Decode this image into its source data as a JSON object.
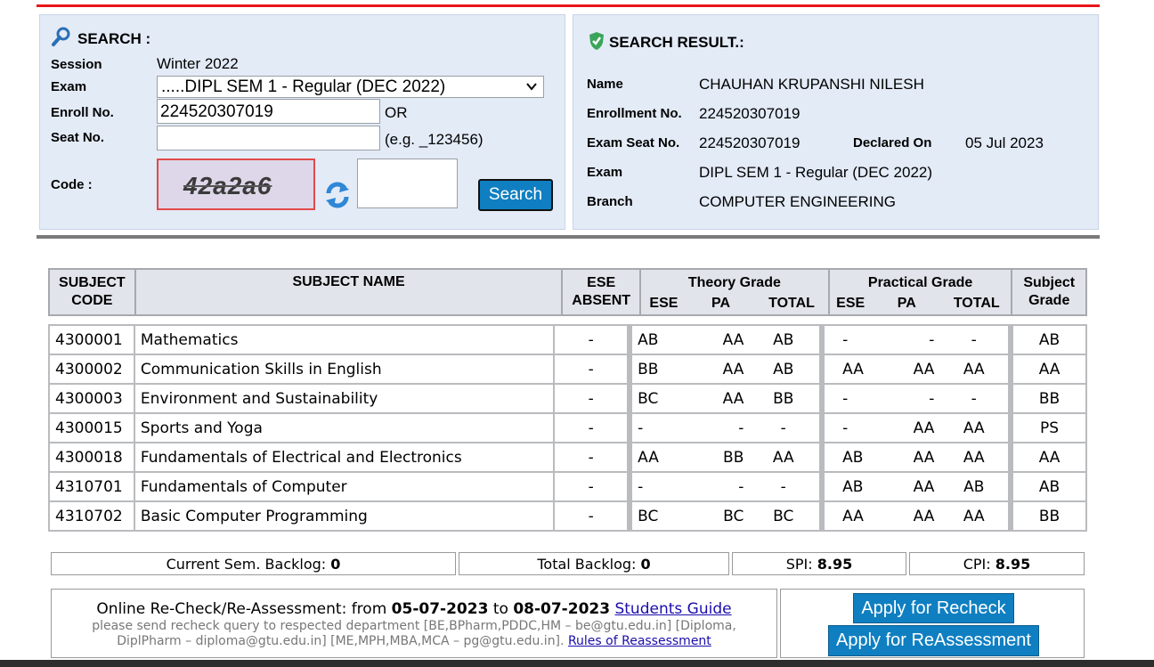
{
  "search_panel": {
    "title": "SEARCH :",
    "session_label": "Session",
    "session_value": "Winter 2022",
    "exam_label": "Exam",
    "exam_selected": ".....DIPL SEM 1 - Regular (DEC 2022)",
    "enroll_label": "Enroll No.",
    "enroll_value": "224520307019",
    "or_text": "OR",
    "seat_label": "Seat No.",
    "seat_value": "",
    "seat_hint": "(e.g. _123456)",
    "code_label": "Code :",
    "captcha_text": "42a2a6",
    "code_value": "",
    "search_button": "Search"
  },
  "result_panel": {
    "title": "SEARCH RESULT.:",
    "name_label": "Name",
    "name_value": "CHAUHAN KRUPANSHI NILESH",
    "enrollment_label": "Enrollment No.",
    "enrollment_value": "224520307019",
    "seat_label": "Exam Seat No.",
    "seat_value": "224520307019",
    "declared_label": "Declared On",
    "declared_value": "05 Jul 2023",
    "exam_label": "Exam",
    "exam_value": "DIPL SEM 1 - Regular (DEC 2022)",
    "branch_label": "Branch",
    "branch_value": "COMPUTER ENGINEERING"
  },
  "table_header": {
    "subject_code_1": "SUBJECT",
    "subject_code_2": "CODE",
    "subject_name": "SUBJECT NAME",
    "ese_absent_1": "ESE",
    "ese_absent_2": "ABSENT",
    "theory_grade": "Theory Grade",
    "practical_grade": "Practical Grade",
    "subject_grade_1": "Subject",
    "subject_grade_2": "Grade",
    "sub_ese": "ESE",
    "sub_pa": "PA",
    "sub_total": "TOTAL"
  },
  "rows": [
    {
      "code": "4300001",
      "name": "Mathematics",
      "absent": "-",
      "t_ese": "AB",
      "t_pa": "AA",
      "t_total": "AB",
      "p_ese": "-",
      "p_pa": "-",
      "p_total": "-",
      "grade": "AB"
    },
    {
      "code": "4300002",
      "name": "Communication Skills in English",
      "absent": "-",
      "t_ese": "BB",
      "t_pa": "AA",
      "t_total": "AB",
      "p_ese": "AA",
      "p_pa": "AA",
      "p_total": "AA",
      "grade": "AA"
    },
    {
      "code": "4300003",
      "name": "Environment and Sustainability",
      "absent": "-",
      "t_ese": "BC",
      "t_pa": "AA",
      "t_total": "BB",
      "p_ese": "-",
      "p_pa": "-",
      "p_total": "-",
      "grade": "BB"
    },
    {
      "code": "4300015",
      "name": "Sports and Yoga",
      "absent": "-",
      "t_ese": "-",
      "t_pa": "-",
      "t_total": "-",
      "p_ese": "-",
      "p_pa": "AA",
      "p_total": "AA",
      "grade": "PS"
    },
    {
      "code": "4300018",
      "name": "Fundamentals of Electrical and Electronics",
      "absent": "-",
      "t_ese": "AA",
      "t_pa": "BB",
      "t_total": "AA",
      "p_ese": "AB",
      "p_pa": "AA",
      "p_total": "AA",
      "grade": "AA"
    },
    {
      "code": "4310701",
      "name": "Fundamentals of Computer",
      "absent": "-",
      "t_ese": "-",
      "t_pa": "-",
      "t_total": "-",
      "p_ese": "AB",
      "p_pa": "AA",
      "p_total": "AB",
      "grade": "AB"
    },
    {
      "code": "4310702",
      "name": "Basic Computer Programming",
      "absent": "-",
      "t_ese": "BC",
      "t_pa": "BC",
      "t_total": "BC",
      "p_ese": "AA",
      "p_pa": "AA",
      "p_total": "AA",
      "grade": "BB"
    }
  ],
  "summary": {
    "current_backlog_label": "Current Sem. Backlog:",
    "current_backlog_value": "0",
    "total_backlog_label": "Total Backlog:",
    "total_backlog_value": "0",
    "spi_label": "SPI:",
    "spi_value": "8.95",
    "cpi_label": "CPI:",
    "cpi_value": "8.95"
  },
  "recheck": {
    "text_prefix": "Online Re-Check/Re-Assessment: from",
    "from_date": "05-07-2023",
    "to_text": "to",
    "to_date": "08-07-2023",
    "students_guide": "Students Guide",
    "note_line1": "please send recheck query to respected department [BE,BPharm,PDDC,HM – be@gtu.edu.in] [Diploma,",
    "note_line2": "DiplPharm – diploma@gtu.edu.in] [ME,MPH,MBA,MCA – pg@gtu.edu.in].",
    "rules_link": "Rules of Reassessment",
    "apply_recheck": "Apply for Recheck",
    "apply_reassessment": "Apply for ReAssessment"
  },
  "colors": {
    "accent_red": "#e8151b",
    "panel_bg": "#e3ebf7",
    "button_blue": "#0f7fc1"
  },
  "icons": {
    "search": "magnifier-icon",
    "result": "shield-check-icon",
    "refresh": "refresh-icon",
    "dropdown": "chevron-down-icon"
  }
}
